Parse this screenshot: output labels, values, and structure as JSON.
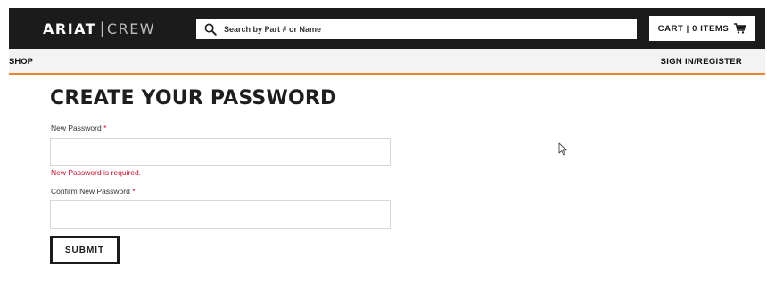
{
  "header": {
    "brand_main": "ARIAT",
    "brand_separator": "|",
    "brand_sub": "CREW",
    "search": {
      "placeholder": "Search by Part # or Name",
      "icon": "search-icon"
    },
    "cart": {
      "label": "CART | 0 ITEMS",
      "icon": "cart-icon"
    }
  },
  "nav": {
    "shop": "SHOP",
    "sign_in": "SIGN IN/REGISTER",
    "accent_color": "#e8852b"
  },
  "form": {
    "title": "CREATE YOUR PASSWORD",
    "new_password": {
      "label": "New Password",
      "required_mark": "*",
      "value": "",
      "error": "New Password is required."
    },
    "confirm_password": {
      "label": "Confirm New Password",
      "required_mark": "*",
      "value": ""
    },
    "submit_label": "SUBMIT"
  },
  "colors": {
    "header_bg": "#1b1b1b",
    "nav_bg": "#f3f3f3",
    "error": "#c8102e"
  }
}
